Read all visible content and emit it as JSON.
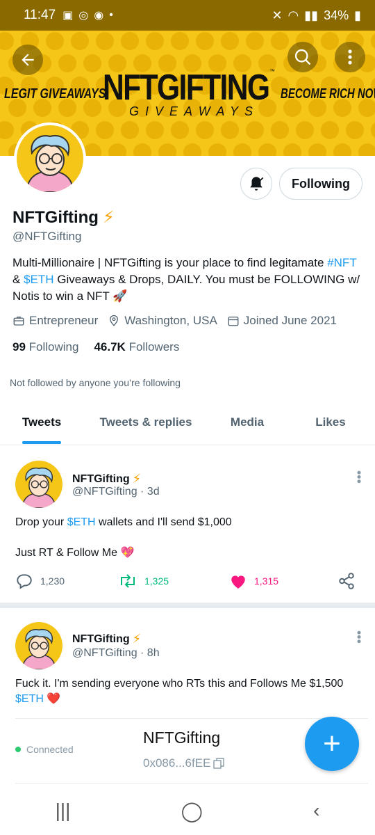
{
  "status_bar": {
    "time": "11:47",
    "battery": "34%"
  },
  "banner": {
    "title": "NFTGIFTING",
    "trademark": "™",
    "subtitle": "GIVEAWAYS",
    "left_tagline": "LEGIT GIVEAWAYS",
    "right_tagline": "BECOME RICH NOW"
  },
  "profile": {
    "name": "NFTGifting",
    "handle": "@NFTGifting",
    "bio_part1": "Multi-Millionaire | NFTGifting is your place to find legitamate ",
    "bio_link1": "#NFT",
    "bio_part2": " & ",
    "bio_link2": "$ETH",
    "bio_part3": " Giveaways & Drops, DAILY. You must be FOLLOWING w/ Notis to win a NFT 🚀",
    "occupation": "Entrepreneur",
    "location": "Washington, USA",
    "joined": "Joined June 2021",
    "following_count": "99",
    "following_label": "Following",
    "followers_count": "46.7K",
    "followers_label": "Followers",
    "not_followed_note": "Not followed by anyone you’re following",
    "follow_button_label": "Following"
  },
  "tabs": [
    {
      "label": "Tweets",
      "active": true
    },
    {
      "label": "Tweets & replies",
      "active": false
    },
    {
      "label": "Media",
      "active": false
    },
    {
      "label": "Likes",
      "active": false
    }
  ],
  "tweets": [
    {
      "name": "NFTGifting",
      "handle_time": "@NFTGifting · 3d",
      "text_part1": "Drop your ",
      "text_link": "$ETH",
      "text_part2": " wallets and I'll send $1,000",
      "text_line2": "Just RT & Follow Me 💖",
      "replies": "1,230",
      "retweets": "1,325",
      "likes": "1,315"
    },
    {
      "name": "NFTGifting",
      "handle_time": "@NFTGifting · 8h",
      "text_part1": "Fuck it. I'm sending everyone who RTs this and Follows Me $1,500 ",
      "text_link": "$ETH",
      "text_part2": " ❤️"
    }
  ],
  "wallet": {
    "status": "Connected",
    "name": "NFTGifting",
    "address": "0x086...6fEE"
  },
  "colors": {
    "accent": "#1d9bf0",
    "banner_yellow": "#f5c518",
    "like_pink": "#f91880",
    "retweet_green": "#00ba7c"
  }
}
